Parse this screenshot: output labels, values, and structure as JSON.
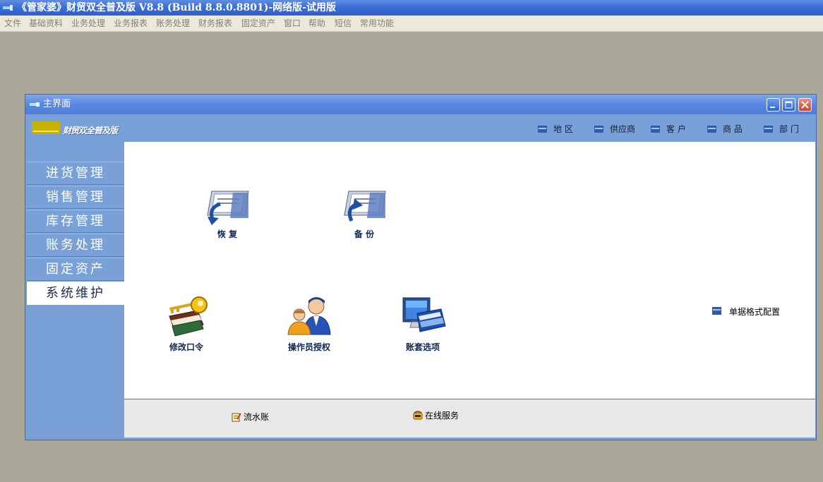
{
  "app": {
    "title": "《管家婆》财贸双全普及版 V8.8 (Build 8.8.0.8801)-网络版-试用版"
  },
  "menubar": {
    "items": [
      "文件",
      "基础资料",
      "业务处理",
      "业务报表",
      "账务处理",
      "财务报表",
      "固定资产",
      "窗口",
      "帮助",
      "短信",
      "常用功能"
    ]
  },
  "window": {
    "title": "主界面",
    "brand": "财贸双全普及版",
    "shortcuts": [
      "地 区",
      "供应商",
      "客 户",
      "商 品",
      "部 门"
    ]
  },
  "sidebar": {
    "items": [
      {
        "label": "进货管理",
        "active": false
      },
      {
        "label": "销售管理",
        "active": false
      },
      {
        "label": "库存管理",
        "active": false
      },
      {
        "label": "账务处理",
        "active": false
      },
      {
        "label": "固定资产",
        "active": false
      },
      {
        "label": "系统维护",
        "active": true
      }
    ]
  },
  "content": {
    "functions": [
      {
        "label": "恢 复",
        "icon": "restore-icon"
      },
      {
        "label": "备 份",
        "icon": "backup-icon"
      },
      {
        "label": "修改口令",
        "icon": "change-password-icon"
      },
      {
        "label": "操作员授权",
        "icon": "operator-authorization-icon"
      },
      {
        "label": "账套选项",
        "icon": "account-set-options-icon"
      }
    ],
    "config_link": "单据格式配置"
  },
  "bottom": {
    "items": [
      {
        "label": "流水账",
        "icon": "journal-icon"
      },
      {
        "label": "在线服务",
        "icon": "online-service-icon"
      }
    ]
  },
  "colors": {
    "titlebar": "#3a6cd4",
    "panel_blue": "#7aa0d8",
    "desktop": "#aca899",
    "menubar": "#ece9d8"
  }
}
